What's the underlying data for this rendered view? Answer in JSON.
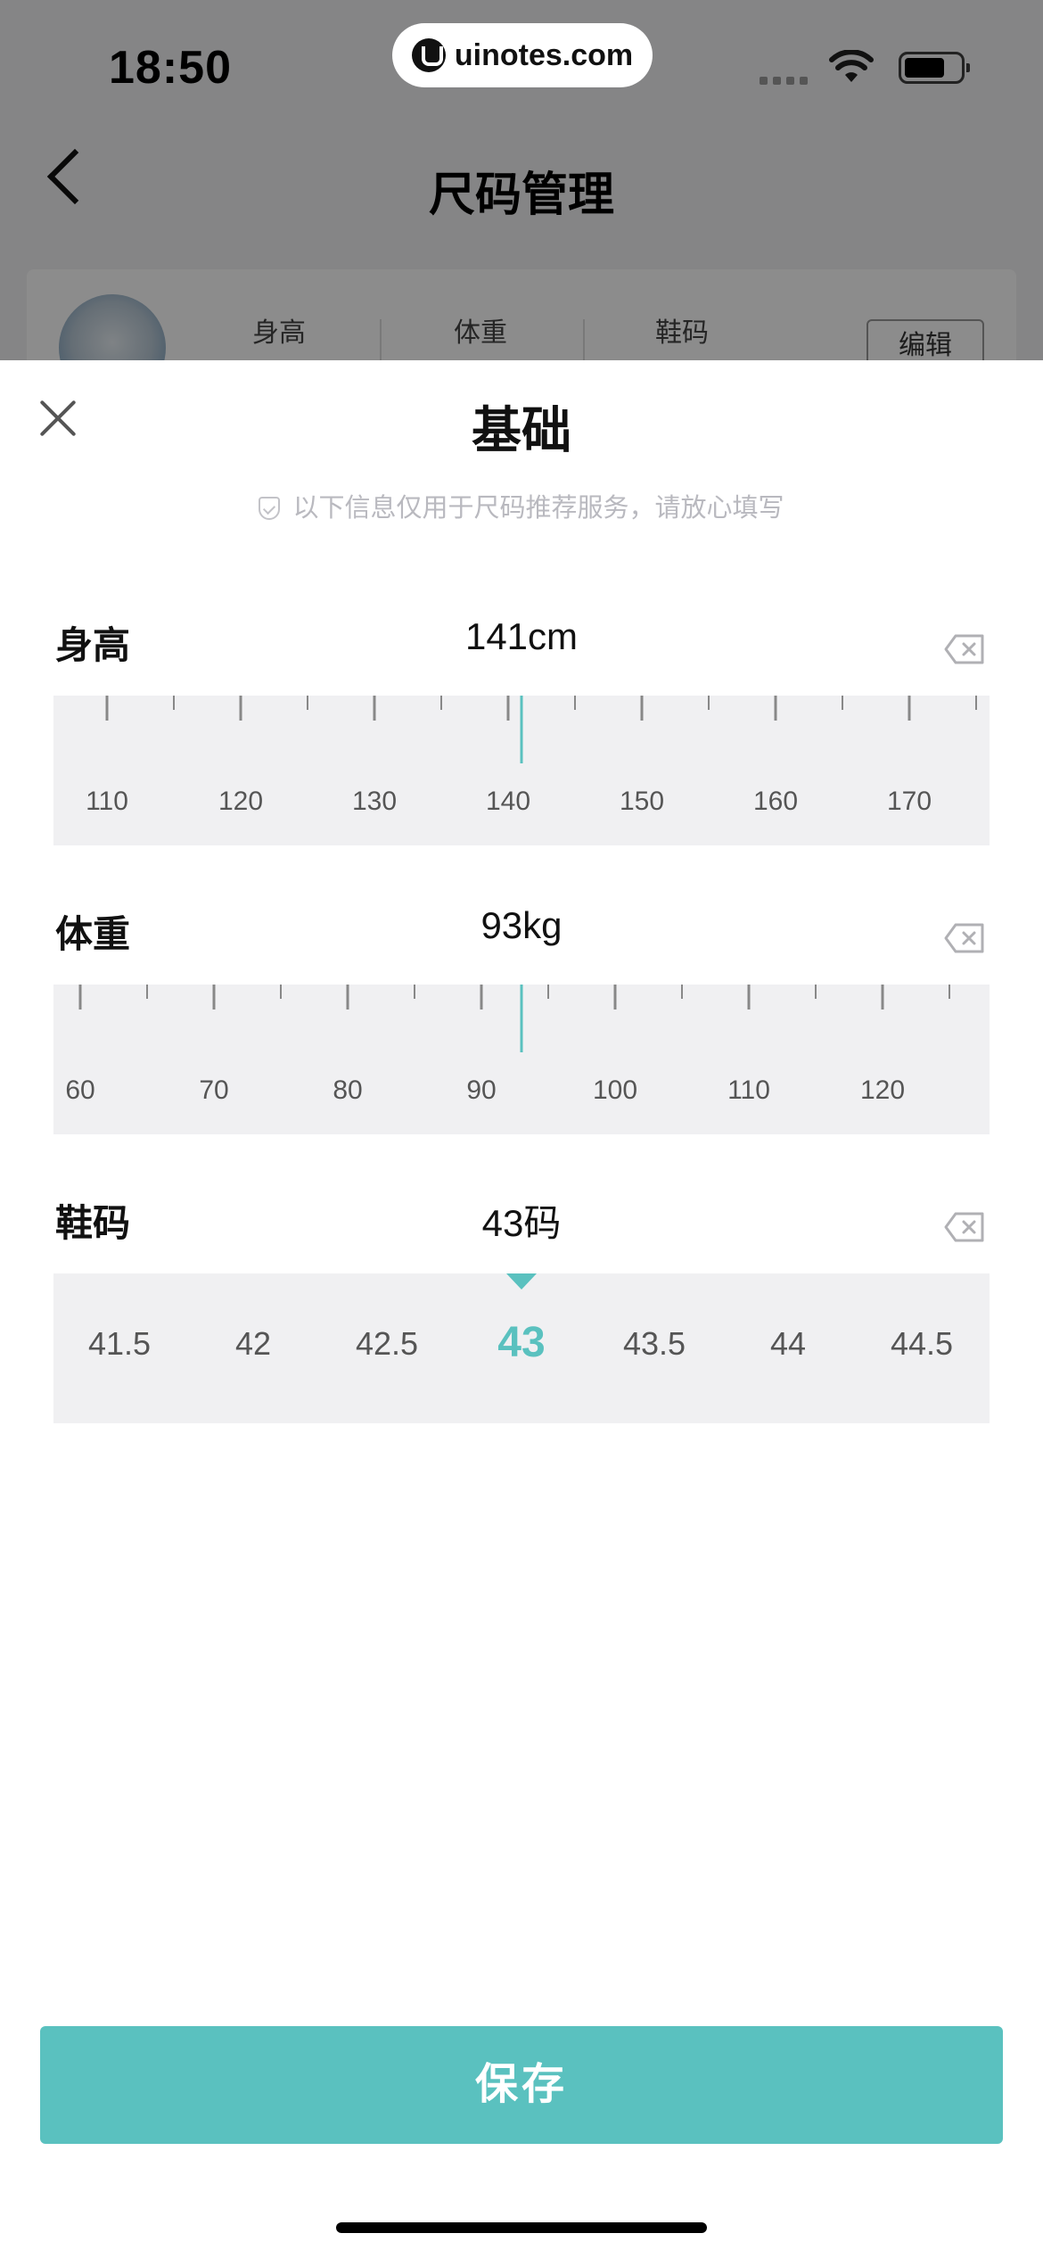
{
  "status_bar": {
    "time": "18:50",
    "url": "uinotes.com"
  },
  "header": {
    "title": "尺码管理"
  },
  "profile": {
    "stats": [
      "身高",
      "体重",
      "鞋码"
    ],
    "edit_label": "编辑"
  },
  "sheet": {
    "title": "基础",
    "notice": "以下信息仅用于尺码推荐服务，请放心填写",
    "height": {
      "label": "身高",
      "value": "141cm",
      "current": 141,
      "ticks": [
        "110",
        "120",
        "130",
        "140",
        "150",
        "160",
        "170"
      ]
    },
    "weight": {
      "label": "体重",
      "value": "93kg",
      "current": 93,
      "ticks": [
        "60",
        "70",
        "80",
        "90",
        "100",
        "110",
        "120"
      ]
    },
    "shoe": {
      "label": "鞋码",
      "value": "43码",
      "options": [
        "41.5",
        "42",
        "42.5",
        "43",
        "43.5",
        "44",
        "44.5"
      ],
      "selected": "43"
    }
  },
  "save_label": "保存",
  "colors": {
    "accent": "#5ac1bf",
    "ruler_bg": "#f0f0f2",
    "dim_overlay": "rgba(0,0,0,0.45)"
  }
}
